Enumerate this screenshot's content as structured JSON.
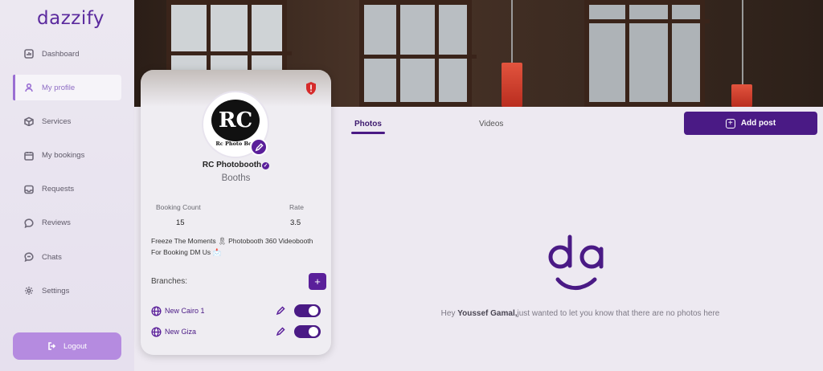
{
  "app": {
    "logo": "dazzify"
  },
  "sidebar": {
    "items": [
      {
        "label": "Dashboard",
        "icon": "chart-icon",
        "active": false
      },
      {
        "label": "My profile",
        "icon": "user-icon",
        "active": true
      },
      {
        "label": "Services",
        "icon": "box-icon",
        "active": false
      },
      {
        "label": "My bookings",
        "icon": "calendar-icon",
        "active": false
      },
      {
        "label": "Requests",
        "icon": "inbox-icon",
        "active": false
      },
      {
        "label": "Reviews",
        "icon": "speech-bubble-icon",
        "active": false
      },
      {
        "label": "Chats",
        "icon": "chat-icon",
        "active": false
      },
      {
        "label": "Settings",
        "icon": "gear-icon",
        "active": false
      }
    ],
    "logout_label": "Logout"
  },
  "profile": {
    "avatar_text": "RC",
    "avatar_brand": "Rc Photo Boo",
    "name": "RC Photobooth",
    "category": "Booths",
    "booking_count_label": "Booking Count",
    "booking_count": "15",
    "rate_label": "Rate",
    "rate": "3.5",
    "bio": "Freeze The Moments 🎗 Photobooth 360 Videobooth For Booking DM Us 📩",
    "branches_label": "Branches:",
    "branches": [
      {
        "name": "New Cairo 1",
        "enabled": true
      },
      {
        "name": "New Giza",
        "enabled": true
      }
    ]
  },
  "content": {
    "tabs": [
      {
        "label": "Photos",
        "active": true
      },
      {
        "label": "Videos",
        "active": false
      }
    ],
    "add_post_label": "Add post",
    "empty_prefix": "Hey ",
    "empty_user": "Youssef Gamal,",
    "empty_suffix": "just wanted to let you know that there are no photos here"
  },
  "colors": {
    "primary": "#4a1a85",
    "accent": "#9a6fd3",
    "logout_bg": "#b58be0",
    "alert": "#d62b2b"
  }
}
